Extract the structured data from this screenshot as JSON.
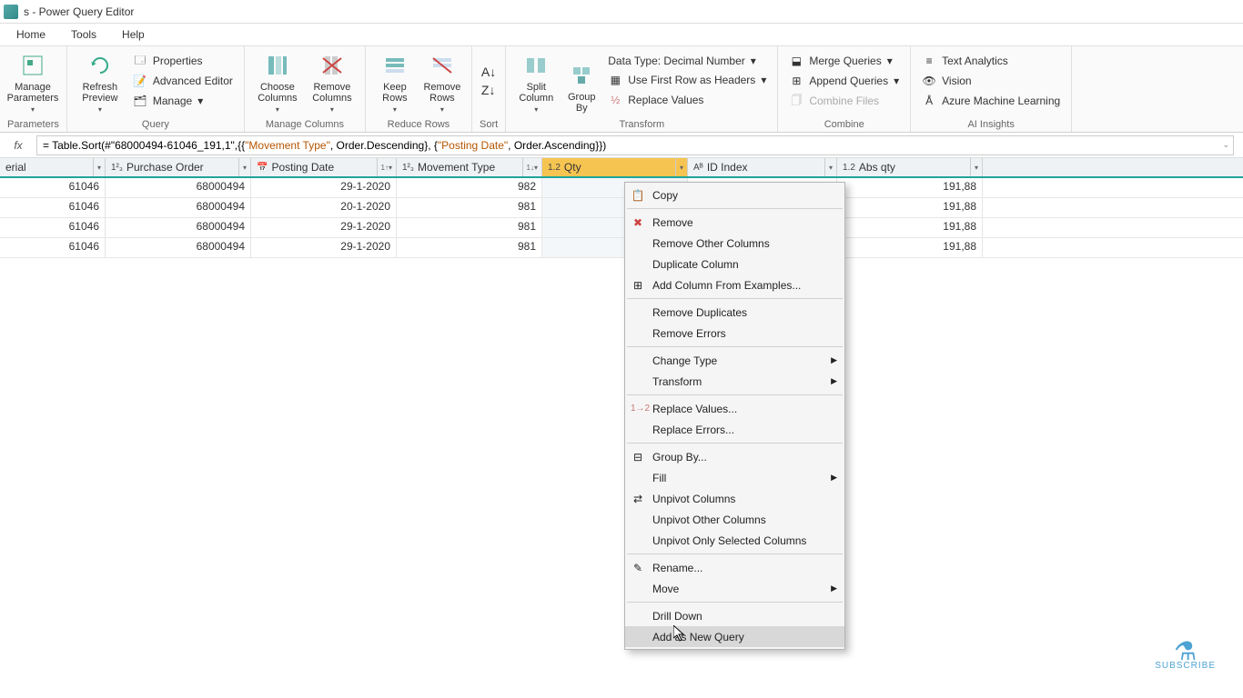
{
  "title": "s - Power Query Editor",
  "menu": {
    "home": "Home",
    "tools": "Tools",
    "help": "Help"
  },
  "ribbon": {
    "manage_params": "Manage\nParameters",
    "params_lbl": "Parameters",
    "refresh": "Refresh\nPreview",
    "properties": "Properties",
    "adv_editor": "Advanced Editor",
    "manage": "Manage",
    "query_lbl": "Query",
    "choose_cols": "Choose\nColumns",
    "remove_cols": "Remove\nColumns",
    "manage_cols_lbl": "Manage Columns",
    "keep_rows": "Keep\nRows",
    "remove_rows": "Remove\nRows",
    "reduce_rows_lbl": "Reduce Rows",
    "sort_lbl": "Sort",
    "split_col": "Split\nColumn",
    "group_by": "Group\nBy",
    "data_type": "Data Type: Decimal Number",
    "first_row": "Use First Row as Headers",
    "replace_vals": "Replace Values",
    "transform_lbl": "Transform",
    "merge_q": "Merge Queries",
    "append_q": "Append Queries",
    "combine_files": "Combine Files",
    "combine_lbl": "Combine",
    "text_an": "Text Analytics",
    "vision": "Vision",
    "azure_ml": "Azure Machine Learning",
    "ai_lbl": "AI Insights"
  },
  "formula": {
    "prefix": "= Table.Sort(#\"68000494-61046_191,1\",{{",
    "mt": "\"Movement Type\"",
    "mid1": ", Order.Descending}, {",
    "pd": "\"Posting Date\"",
    "suffix": ", Order.Ascending}})"
  },
  "columns": {
    "material": "erial",
    "po": "Purchase Order",
    "date": "Posting Date",
    "mt": "Movement Type",
    "qty": "Qty",
    "id": "ID Index",
    "abs": "Abs qty"
  },
  "rows": [
    {
      "mat": "61046",
      "po": "68000494",
      "date": "29-1-2020",
      "mt": "982",
      "abs": "191,88"
    },
    {
      "mat": "61046",
      "po": "68000494",
      "date": "20-1-2020",
      "mt": "981",
      "abs": "191,88"
    },
    {
      "mat": "61046",
      "po": "68000494",
      "date": "29-1-2020",
      "mt": "981",
      "abs": "191,88"
    },
    {
      "mat": "61046",
      "po": "68000494",
      "date": "29-1-2020",
      "mt": "981",
      "abs": "191,88"
    }
  ],
  "ctx": {
    "copy": "Copy",
    "remove": "Remove",
    "remove_other": "Remove Other Columns",
    "dup": "Duplicate Column",
    "add_ex": "Add Column From Examples...",
    "rem_dup": "Remove Duplicates",
    "rem_err": "Remove Errors",
    "chg_type": "Change Type",
    "transform": "Transform",
    "rep_val": "Replace Values...",
    "rep_err": "Replace Errors...",
    "group": "Group By...",
    "fill": "Fill",
    "unpivot": "Unpivot Columns",
    "unpivot_other": "Unpivot Other Columns",
    "unpivot_sel": "Unpivot Only Selected Columns",
    "rename": "Rename...",
    "move": "Move",
    "drill": "Drill Down",
    "add_new": "Add as New Query"
  },
  "subscribe": "SUBSCRIBE"
}
